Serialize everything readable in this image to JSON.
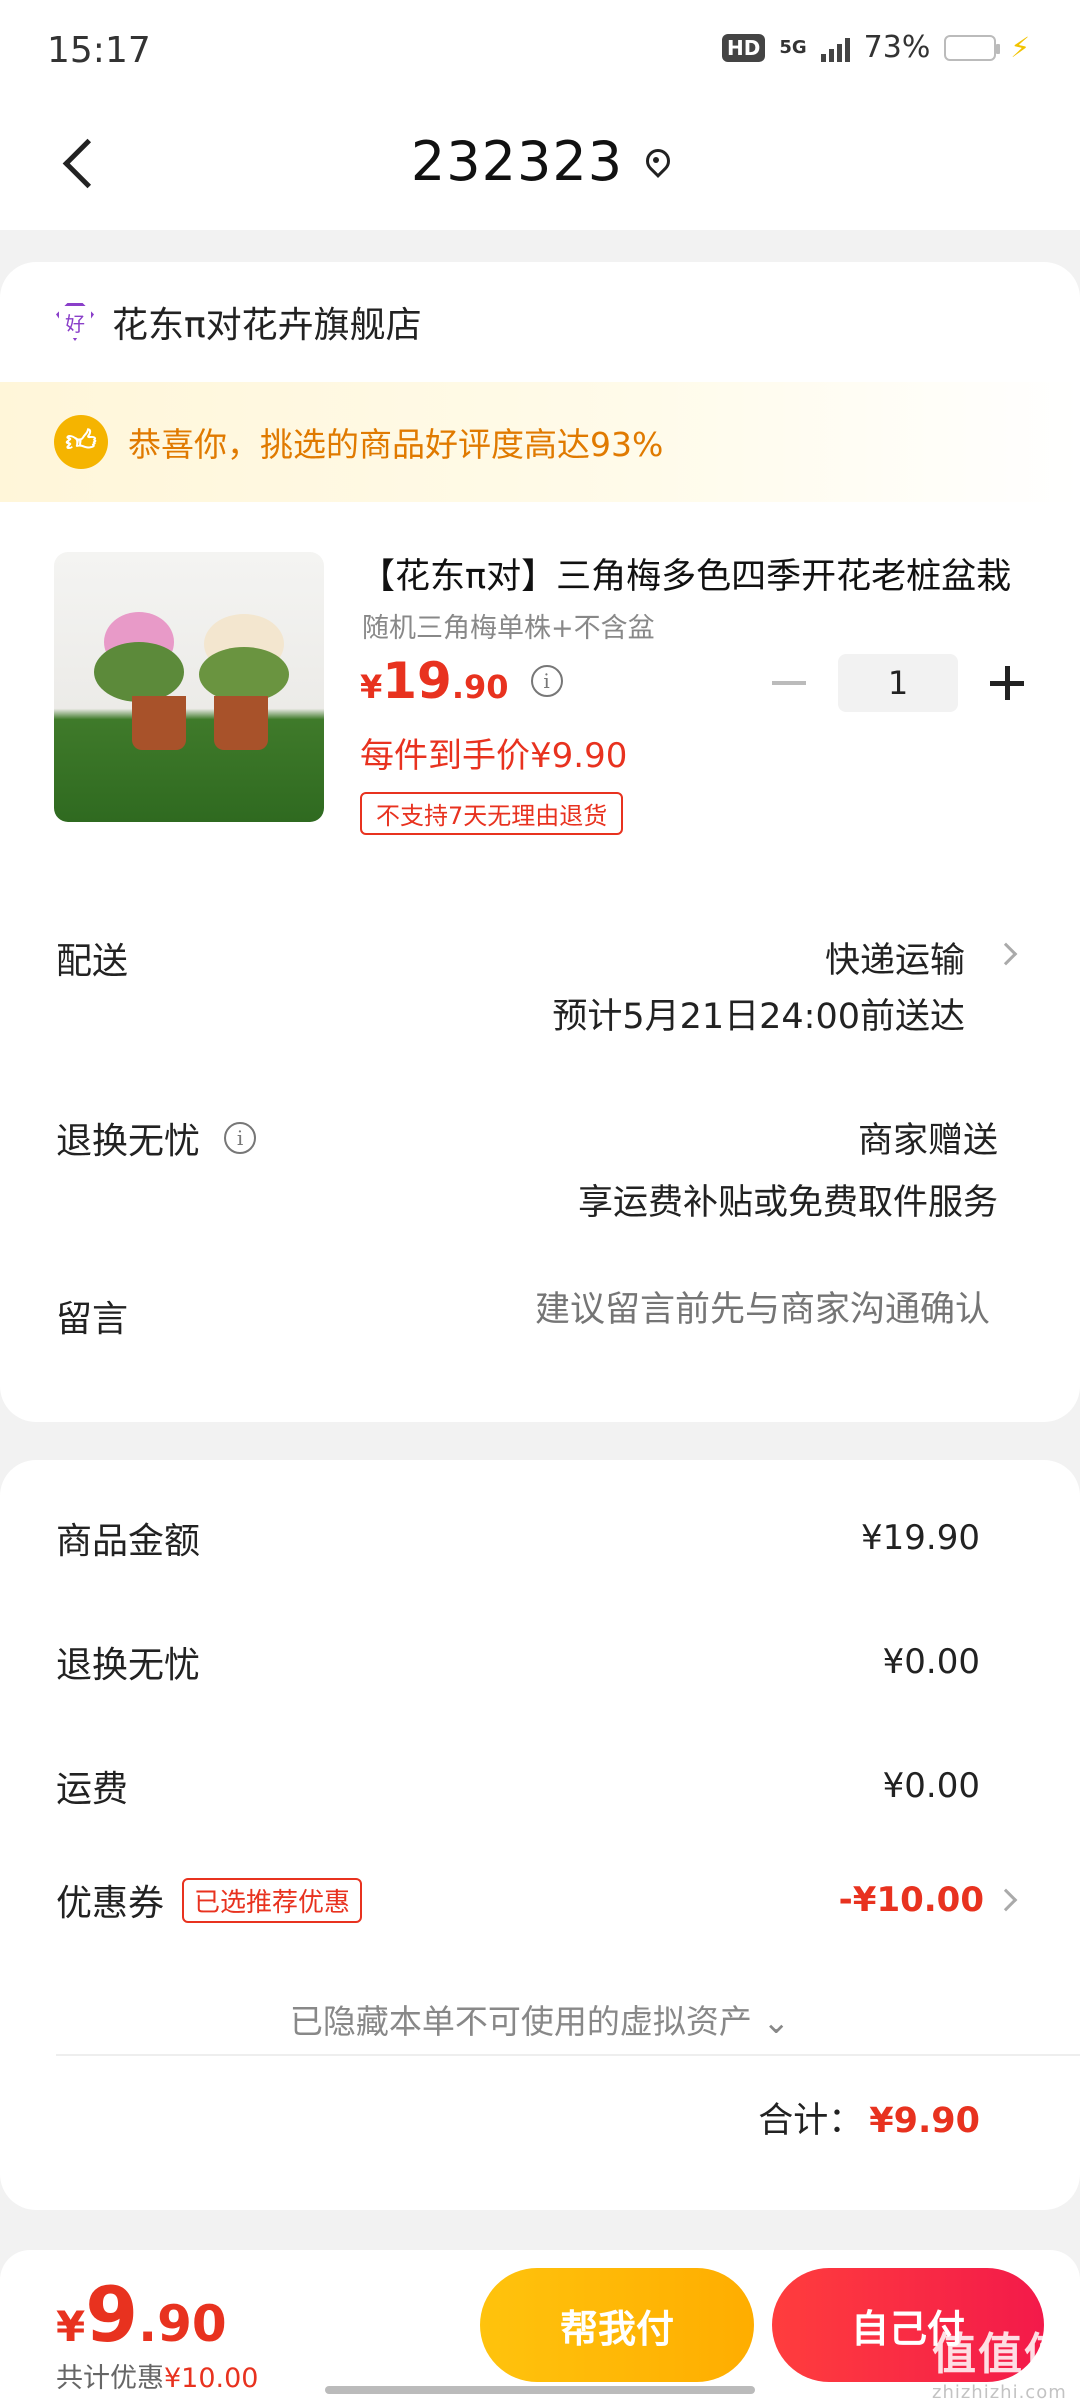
{
  "status_bar": {
    "time": "15:17",
    "hd": "HD",
    "network": "5G",
    "battery": "73%"
  },
  "header": {
    "title": "232323"
  },
  "shop": {
    "icon_text": "好",
    "name": "花东π对花卉旗舰店"
  },
  "banner": {
    "text": "恭喜你，挑选的商品好评度高达93%"
  },
  "product": {
    "title": "【花东π对】三角梅多色四季开花老桩盆栽",
    "spec": "随机三角梅单株+不含盆",
    "price_currency": "¥",
    "price_int": "19",
    "price_dec": ".90",
    "quantity": "1",
    "unit_price": "每件到手价¥9.90",
    "return_tag": "不支持7天无理由退货"
  },
  "delivery": {
    "label": "配送",
    "method": "快递运输",
    "eta": "预计5月21日24:00前送达"
  },
  "refund": {
    "label": "退换无忧",
    "value1": "商家赠送",
    "value2": "享运费补贴或免费取件服务"
  },
  "message": {
    "label": "留言",
    "placeholder": "建议留言前先与商家沟通确认"
  },
  "summary": {
    "goods_label": "商品金额",
    "goods_value": "¥19.90",
    "refund_label": "退换无忧",
    "refund_value": "¥0.00",
    "shipping_label": "运费",
    "shipping_value": "¥0.00",
    "coupon_label": "优惠券",
    "coupon_badge": "已选推荐优惠",
    "coupon_value": "-¥10.00",
    "hidden_assets": "已隐藏本单不可使用的虚拟资产 ⌄",
    "total_label": "合计：",
    "total_value": "¥9.90"
  },
  "bottom": {
    "currency": "¥",
    "price_int": "9",
    "price_dec": ".90",
    "saved_label": "共计优惠",
    "saved_value": "¥10.00",
    "help_pay": "帮我付",
    "self_pay": "自己付"
  },
  "watermark": {
    "main": "值值值",
    "sub": "zhizhizhi.com"
  },
  "colors": {
    "accent_red": "#e8321f",
    "accent_yellow": "#ffb800",
    "banner_text": "#e07a00"
  }
}
